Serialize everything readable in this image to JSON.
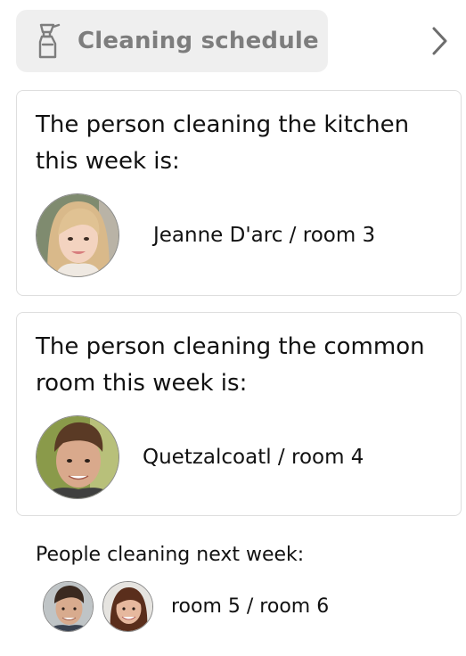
{
  "header": {
    "title": "Cleaning schedule",
    "icon": "spray-bottle-icon",
    "next_icon": "chevron-right-icon"
  },
  "kitchen": {
    "title": "The person cleaning the kitchen this week is:",
    "assignee": "Jeanne D'arc / room 3"
  },
  "common_room": {
    "title": "The person cleaning the common room this week is:",
    "assignee": "Quetzalcoatl / room 4"
  },
  "next_week": {
    "label": "People cleaning next week:",
    "rooms": "room 5 / room 6"
  }
}
